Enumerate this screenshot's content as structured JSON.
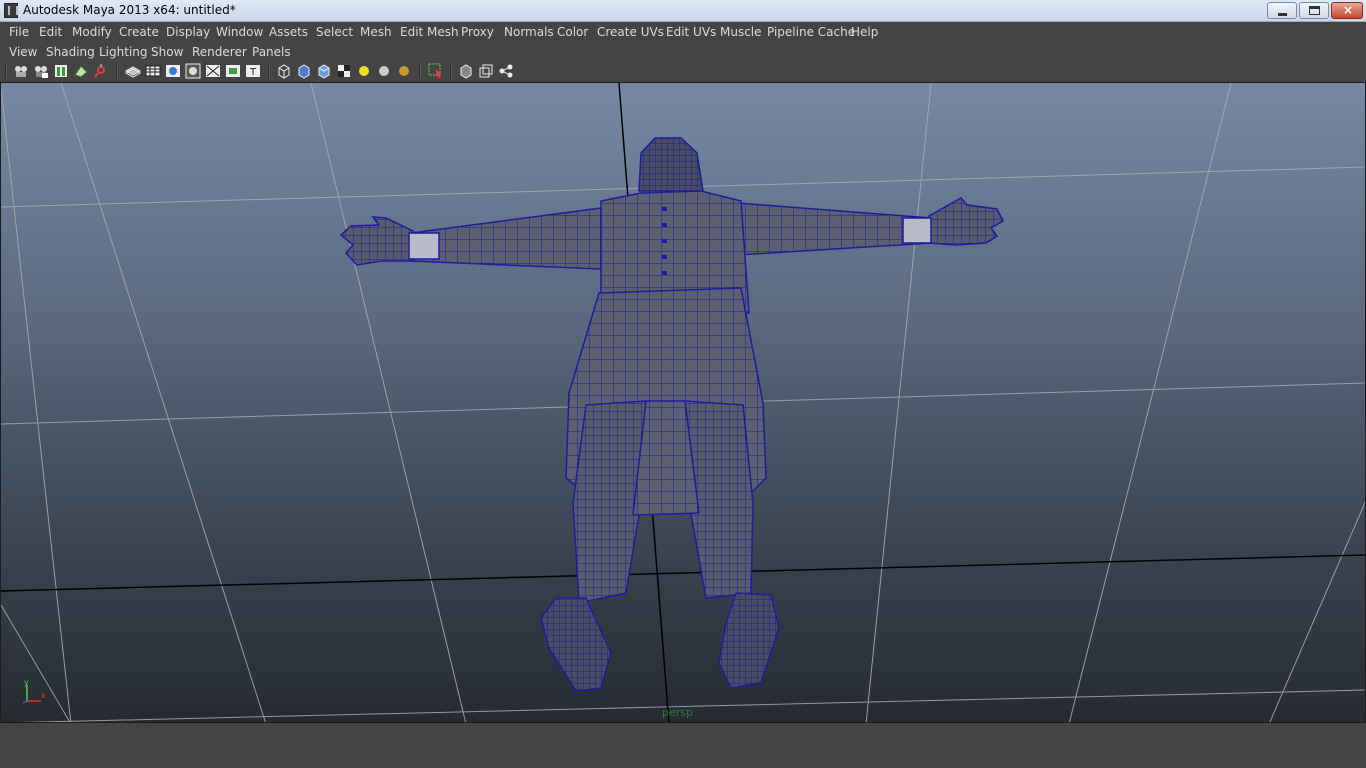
{
  "window": {
    "title": "Autodesk Maya 2013 x64: untitled*",
    "controls": {
      "minimize": "minimize-icon",
      "maximize": "maximize-icon",
      "close": "×"
    }
  },
  "main_menu": [
    {
      "label": "File"
    },
    {
      "label": "Edit"
    },
    {
      "label": "Modify"
    },
    {
      "label": "Create"
    },
    {
      "label": "Display"
    },
    {
      "label": "Window"
    },
    {
      "label": "Assets"
    },
    {
      "label": "Select"
    },
    {
      "label": "Mesh"
    },
    {
      "label": "Edit Mesh"
    },
    {
      "label": "Proxy"
    },
    {
      "label": "Normals"
    },
    {
      "label": "Color"
    },
    {
      "label": "Create UVs"
    },
    {
      "label": "Edit UVs"
    },
    {
      "label": "Muscle"
    },
    {
      "label": "Pipeline Cache"
    },
    {
      "label": "Help"
    }
  ],
  "panel_menu": [
    {
      "label": "View"
    },
    {
      "label": "Shading"
    },
    {
      "label": "Lighting"
    },
    {
      "label": "Show"
    },
    {
      "label": "Renderer"
    },
    {
      "label": "Panels"
    }
  ],
  "panel_toolbar": {
    "icons": [
      "select-camera-icon",
      "camera-attributes-icon",
      "bookmark-icon",
      "image-plane-icon",
      "2d-pan-zoom-icon",
      "grease-pencil-icon",
      "grid-icon",
      "film-gate-icon",
      "resolution-gate-icon",
      "gate-mask-icon",
      "field-chart-icon",
      "safe-action-icon",
      "safe-title-icon",
      "wireframe-icon",
      "smooth-shade-icon",
      "wireframe-on-shaded-icon",
      "textured-icon",
      "use-all-lights-icon",
      "shadows-icon",
      "ambient-occlusion-icon",
      "isolate-select-icon",
      "xray-icon",
      "xray-joints-icon",
      "xray-components-icon"
    ]
  },
  "viewport": {
    "camera_name": "persp",
    "axis_labels": {
      "y": "y",
      "x": "x"
    },
    "colors": {
      "wireframe": "#1c1c9c",
      "mesh_fill": "#5d6070",
      "grid_line": "#a9adb5",
      "axis_line": "#000000",
      "camera_label": "#2a7a3a"
    }
  }
}
